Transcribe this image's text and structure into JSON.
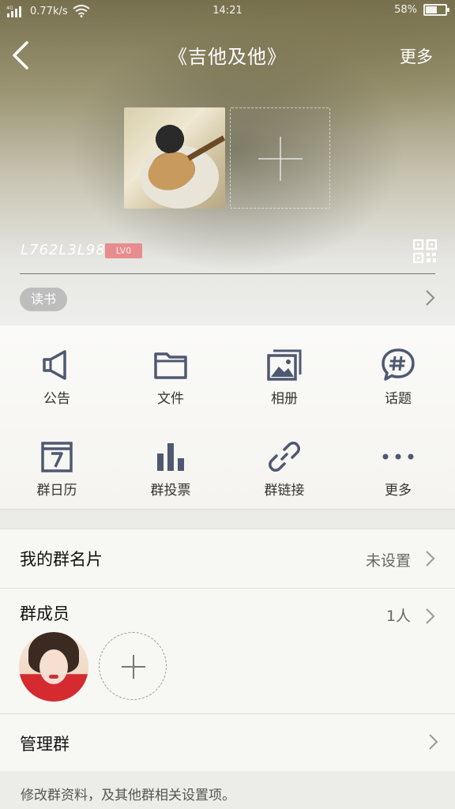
{
  "status_bar": {
    "network": "4G",
    "speed": "0.77k/s",
    "time": "14:21",
    "battery": "58%"
  },
  "header": {
    "title": "《吉他及他》",
    "more_label": "更多"
  },
  "group": {
    "id": "L762L3L98",
    "level": "LV0",
    "tag": "读书"
  },
  "features": [
    {
      "label": "公告",
      "icon": "megaphone-icon"
    },
    {
      "label": "文件",
      "icon": "folder-icon"
    },
    {
      "label": "相册",
      "icon": "album-icon"
    },
    {
      "label": "话题",
      "icon": "topic-hash-icon"
    },
    {
      "label": "群日历",
      "icon": "calendar-icon"
    },
    {
      "label": "群投票",
      "icon": "vote-bars-icon"
    },
    {
      "label": "群链接",
      "icon": "link-icon"
    },
    {
      "label": "更多",
      "icon": "more-dots-icon"
    }
  ],
  "card": {
    "title": "我的群名片",
    "value": "未设置"
  },
  "members": {
    "title": "群成员",
    "count": "1人"
  },
  "manage": {
    "title": "管理群",
    "note": "修改群资料，及其他群相关设置项。"
  },
  "colors": {
    "icon": "#4e5871",
    "badge": "#e88d8f",
    "avatar_shirt": "#d52a2f"
  }
}
